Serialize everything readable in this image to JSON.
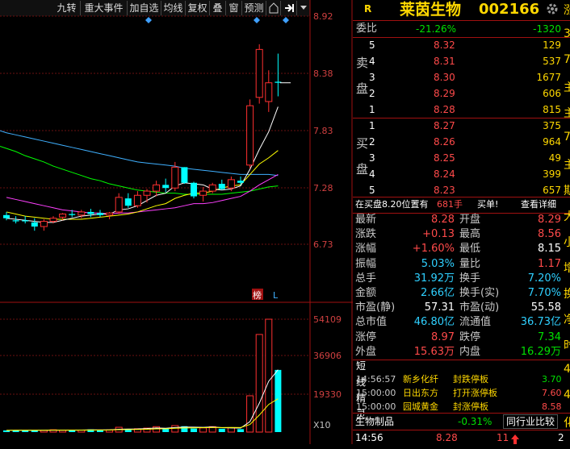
{
  "toolbar": {
    "items": [
      "九转",
      "重大事件",
      "加自选",
      "均线",
      "复权",
      "叠",
      "窗",
      "预测"
    ],
    "home_icon": "home-icon",
    "exit_icon": "exit-icon",
    "dropdown_icon": "chevron-down-icon"
  },
  "chart": {
    "price_axis": [
      "8.92",
      "8.38",
      "7.83",
      "7.28",
      "6.73"
    ],
    "volume_axis": [
      "54109",
      "36906",
      "19330"
    ],
    "volume_unit": "X10",
    "tags": {
      "bang": "榜",
      "l": "L"
    },
    "colors": {
      "up": "#ff3030",
      "down": "#00ffff",
      "ma5": "#ffffff",
      "ma10": "#ffff00",
      "ma20": "#ff40ff",
      "ma30": "#00ff00",
      "ma60": "#3fb0ff"
    }
  },
  "chart_data": {
    "type": "candlestick",
    "series": [
      {
        "o": 7.01,
        "h": 7.04,
        "l": 6.96,
        "c": 6.98
      },
      {
        "o": 6.96,
        "h": 7.0,
        "l": 6.93,
        "c": 6.95
      },
      {
        "o": 6.96,
        "h": 7.0,
        "l": 6.93,
        "c": 6.95
      },
      {
        "o": 6.94,
        "h": 6.98,
        "l": 6.86,
        "c": 6.9
      },
      {
        "o": 6.9,
        "h": 6.97,
        "l": 6.86,
        "c": 6.95
      },
      {
        "o": 6.95,
        "h": 7.0,
        "l": 6.93,
        "c": 6.98
      },
      {
        "o": 6.99,
        "h": 7.03,
        "l": 6.96,
        "c": 7.02
      },
      {
        "o": 7.02,
        "h": 7.06,
        "l": 6.99,
        "c": 7.01
      },
      {
        "o": 7.01,
        "h": 7.06,
        "l": 6.98,
        "c": 7.04
      },
      {
        "o": 7.04,
        "h": 7.07,
        "l": 6.99,
        "c": 7.02
      },
      {
        "o": 7.03,
        "h": 7.06,
        "l": 6.99,
        "c": 7.01
      },
      {
        "o": 7.01,
        "h": 7.04,
        "l": 6.97,
        "c": 7.03
      },
      {
        "o": 7.04,
        "h": 7.22,
        "l": 7.02,
        "c": 7.18
      },
      {
        "o": 7.17,
        "h": 7.22,
        "l": 7.08,
        "c": 7.1
      },
      {
        "o": 7.1,
        "h": 7.24,
        "l": 7.08,
        "c": 7.2
      },
      {
        "o": 7.2,
        "h": 7.26,
        "l": 7.13,
        "c": 7.24
      },
      {
        "o": 7.24,
        "h": 7.34,
        "l": 7.19,
        "c": 7.3
      },
      {
        "o": 7.3,
        "h": 7.36,
        "l": 7.23,
        "c": 7.27
      },
      {
        "o": 7.27,
        "h": 7.52,
        "l": 7.24,
        "c": 7.47
      },
      {
        "o": 7.47,
        "h": 7.47,
        "l": 7.31,
        "c": 7.32
      },
      {
        "o": 7.32,
        "h": 7.33,
        "l": 7.17,
        "c": 7.19
      },
      {
        "o": 7.2,
        "h": 7.28,
        "l": 7.14,
        "c": 7.24
      },
      {
        "o": 7.24,
        "h": 7.32,
        "l": 7.22,
        "c": 7.3
      },
      {
        "o": 7.31,
        "h": 7.35,
        "l": 7.25,
        "c": 7.26
      },
      {
        "o": 7.27,
        "h": 7.38,
        "l": 7.24,
        "c": 7.35
      },
      {
        "o": 7.34,
        "h": 7.38,
        "l": 7.3,
        "c": 7.32
      },
      {
        "o": 7.49,
        "h": 8.12,
        "l": 7.46,
        "c": 8.06
      },
      {
        "o": 8.14,
        "h": 8.65,
        "l": 8.08,
        "c": 8.6
      },
      {
        "o": 8.1,
        "h": 8.4,
        "l": 8.0,
        "c": 8.28
      },
      {
        "o": 8.29,
        "h": 8.56,
        "l": 8.15,
        "c": 8.28
      }
    ],
    "volume": [
      800,
      900,
      850,
      950,
      800,
      1100,
      900,
      1000,
      950,
      1300,
      1100,
      1050,
      2300,
      1500,
      1600,
      1900,
      2600,
      1700,
      3100,
      2800,
      1700,
      2000,
      2600,
      1600,
      2100,
      1400,
      17400,
      46800,
      54109,
      29800
    ],
    "ma": {
      "ma5": [
        6.98,
        6.97,
        6.96,
        6.95,
        6.94,
        6.94,
        6.96,
        6.98,
        7.0,
        7.01,
        7.02,
        7.02,
        7.06,
        7.07,
        7.1,
        7.15,
        7.2,
        7.22,
        7.29,
        7.32,
        7.31,
        7.3,
        7.26,
        7.25,
        7.26,
        7.29,
        7.45,
        7.64,
        7.81,
        8.05
      ],
      "ma10": [
        7.04,
        7.02,
        7.0,
        6.99,
        6.98,
        6.97,
        6.97,
        6.97,
        6.97,
        6.98,
        6.99,
        7.0,
        7.01,
        7.02,
        7.04,
        7.07,
        7.1,
        7.12,
        7.17,
        7.2,
        7.22,
        7.22,
        7.24,
        7.27,
        7.29,
        7.3,
        7.4,
        7.5,
        7.56,
        7.63
      ],
      "ma20": [
        7.18,
        7.16,
        7.14,
        7.12,
        7.1,
        7.08,
        7.06,
        7.05,
        7.04,
        7.03,
        7.03,
        7.02,
        7.03,
        7.03,
        7.04,
        7.05,
        7.06,
        7.07,
        7.08,
        7.1,
        7.12,
        7.12,
        7.13,
        7.15,
        7.17,
        7.19,
        7.24,
        7.3,
        7.35,
        7.4
      ],
      "ma30": [
        7.65,
        7.62,
        7.58,
        7.55,
        7.52,
        7.48,
        7.45,
        7.42,
        7.39,
        7.36,
        7.34,
        7.31,
        7.29,
        7.27,
        7.25,
        7.24,
        7.23,
        7.22,
        7.22,
        7.21,
        7.21,
        7.21,
        7.21,
        7.21,
        7.22,
        7.23,
        7.24,
        7.26,
        7.28,
        7.29
      ],
      "ma60": [
        7.8,
        7.78,
        7.76,
        7.74,
        7.72,
        7.7,
        7.68,
        7.66,
        7.64,
        7.62,
        7.6,
        7.58,
        7.56,
        7.54,
        7.52,
        7.51,
        7.5,
        7.49,
        7.48,
        7.46,
        7.45,
        7.44,
        7.43,
        7.42,
        7.41,
        7.4,
        7.4,
        7.4,
        7.4,
        7.39
      ]
    },
    "ylim": [
      6.73,
      8.92
    ],
    "vol_max": 60000
  },
  "quote": {
    "market_badge": "R",
    "name": "莱茵生物",
    "code": "002166",
    "gear_icon": "gear-icon",
    "weibi_label": "委比",
    "weibi_pct": "-21.26%",
    "weibi_diff": "-1320",
    "sell_label": [
      "卖",
      "盘"
    ],
    "buy_label": [
      "买",
      "盘"
    ],
    "sell": [
      {
        "lvl": "5",
        "price": "8.32",
        "vol": "129"
      },
      {
        "lvl": "4",
        "price": "8.31",
        "vol": "537"
      },
      {
        "lvl": "3",
        "price": "8.30",
        "vol": "1677"
      },
      {
        "lvl": "2",
        "price": "8.29",
        "vol": "606"
      },
      {
        "lvl": "1",
        "price": "8.28",
        "vol": "815"
      }
    ],
    "buy": [
      {
        "lvl": "1",
        "price": "8.27",
        "vol": "375"
      },
      {
        "lvl": "2",
        "price": "8.26",
        "vol": "964"
      },
      {
        "lvl": "3",
        "price": "8.25",
        "vol": "49"
      },
      {
        "lvl": "4",
        "price": "8.24",
        "vol": "399"
      },
      {
        "lvl": "5",
        "price": "8.23",
        "vol": "657"
      }
    ],
    "buy_bar": {
      "text": "在买盘8.20位置有",
      "amount": "681手",
      "tag": "买单!",
      "detail": "查看详细"
    },
    "stats": [
      {
        "l1": "最新",
        "v1": "8.28",
        "c1": "red",
        "l2": "开盘",
        "v2": "8.29",
        "c2": "red"
      },
      {
        "l1": "涨跌",
        "v1": "+0.13",
        "c1": "red",
        "l2": "最高",
        "v2": "8.56",
        "c2": "red"
      },
      {
        "l1": "涨幅",
        "v1": "+1.60%",
        "c1": "red",
        "l2": "最低",
        "v2": "8.15",
        "c2": "white"
      },
      {
        "l1": "振幅",
        "v1": "5.03%",
        "c1": "cyan",
        "l2": "量比",
        "v2": "1.17",
        "c2": "red"
      },
      {
        "l1": "总手",
        "v1": "31.92万",
        "c1": "cyan",
        "l2": "换手",
        "v2": "7.20%",
        "c2": "cyan"
      },
      {
        "l1": "金额",
        "v1": "2.66亿",
        "c1": "cyan",
        "l2": "换手(实)",
        "v2": "7.70%",
        "c2": "cyan"
      },
      {
        "l1": "市盈(静)",
        "v1": "57.31",
        "c1": "white",
        "l2": "市盈(动)",
        "v2": "55.58",
        "c2": "white"
      },
      {
        "l1": "总市值",
        "v1": "46.80亿",
        "c1": "cyan",
        "l2": "流通值",
        "v2": "36.73亿",
        "c2": "cyan"
      },
      {
        "l1": "涨停",
        "v1": "8.97",
        "c1": "red",
        "l2": "跌停",
        "v2": "7.34",
        "c2": "green"
      },
      {
        "l1": "外盘",
        "v1": "15.63万",
        "c1": "red",
        "l2": "内盘",
        "v2": "16.29万",
        "c2": "green"
      }
    ],
    "short_title": "短线精灵",
    "short_items": [
      {
        "time": "14:56:57",
        "name": "新乡化纤",
        "event": "封跌停板",
        "val": "3.70",
        "vc": "green"
      },
      {
        "time": "15:00:00",
        "name": "日出东方",
        "event": "打开涨停板",
        "val": "7.60",
        "vc": "red"
      },
      {
        "time": "15:00:00",
        "name": "园城黄金",
        "event": "封涨停板",
        "val": "8.58",
        "vc": "red"
      }
    ],
    "sector": {
      "name": "生物制品",
      "pct": "-0.31%",
      "compare": "同行业比较"
    },
    "footer": {
      "time": "14:56",
      "price": "8.28",
      "vol": "11",
      "arrow": "up-arrow-icon",
      "extra": "2"
    }
  },
  "edge": {
    "chars": [
      "涨",
      "3",
      "7",
      "主",
      "主",
      "7",
      "主",
      "期",
      "大",
      "小",
      "增",
      "换",
      "净",
      "时",
      "4",
      "4",
      "化"
    ]
  }
}
